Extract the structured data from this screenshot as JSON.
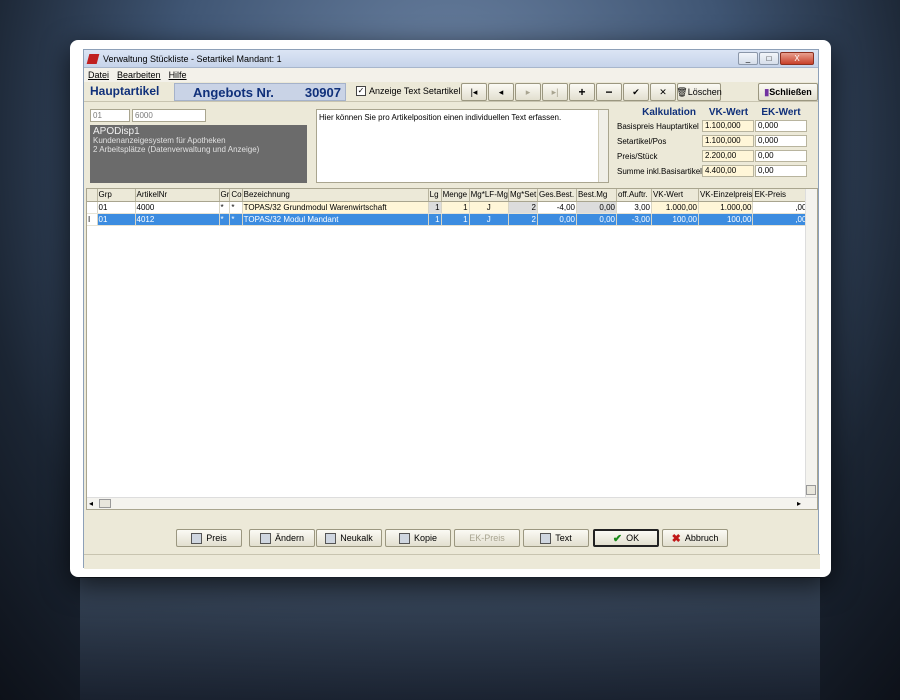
{
  "window": {
    "title": "Verwaltung Stückliste - Setartikel  Mandant: 1",
    "controls": [
      "_",
      "□",
      "X"
    ]
  },
  "menu": [
    "Datei",
    "Bearbeiten",
    "Hilfe"
  ],
  "header": {
    "hauptartikel": "Hauptartikel",
    "angebots_label": "Angebots Nr.",
    "angebots_number": "30907",
    "checkbox_label": "Anzeige Text Setartikel",
    "checkbox_checked": true
  },
  "toolbar": {
    "first": "|◂",
    "prev": "◂",
    "next": "▸",
    "last": "▸|",
    "plus": "+",
    "minus": "−",
    "ok": "✔",
    "cancel": "✕",
    "loeschen": "Löschen",
    "schliessen": "Schließen"
  },
  "article": {
    "grp": "01",
    "artnr": "6000",
    "name": "APODisp1",
    "line1": "Kundenanzeigesystem für Apotheken",
    "line2": "2 Arbeitsplätze (Datenverwaltung und Anzeige)"
  },
  "text_area": "Hier können Sie pro Artikelposition einen individuellen Text erfassen.",
  "kalkulation": {
    "title": "Kalkulation",
    "vk_header": "VK-Wert",
    "ek_header": "EK-Wert",
    "rows": [
      {
        "label": "Basispreis Hauptartikel",
        "vk": "1.100,000",
        "ek": "0,000"
      },
      {
        "label": "Setartikel/Pos",
        "vk": "1.100,000",
        "ek": "0,000"
      },
      {
        "label": "Preis/Stück",
        "vk": "2.200,00",
        "ek": "0,00"
      },
      {
        "label": "Summe inkl.Basisartikel",
        "vk": "4.400,00",
        "ek": "0,00"
      }
    ]
  },
  "table": {
    "headers": [
      "",
      "Grp",
      "ArtikelNr",
      "Gr",
      "Co",
      "Bezeichnung",
      "Lg",
      "Menge",
      "Mg*LF-Mg",
      "Mg*Set",
      "Ges.Best.",
      "Best.Mg",
      "off.Auftr.",
      "VK-Wert",
      "VK-Einzelpreis",
      "EK-Preis"
    ],
    "rows": [
      [
        "",
        "01",
        "4000",
        "*",
        "*",
        "TOPAS/32 Grundmodul  Warenwirtschaft",
        "1",
        "1",
        "J",
        "2",
        "-4,00",
        "0,00",
        "3,00",
        "1.000,00",
        "1.000,00",
        ",00"
      ],
      [
        "I",
        "01",
        "4012",
        "*",
        "*",
        "TOPAS/32 Modul Mandant",
        "1",
        "1",
        "J",
        "2",
        "0,00",
        "0,00",
        "-3,00",
        "100,00",
        "100,00",
        ",00"
      ]
    ]
  },
  "buttons": {
    "preis": "Preis",
    "aendern": "Ändern",
    "neukalk": "Neukalk",
    "kopie": "Kopie",
    "ekpreis": "EK-Preis",
    "text": "Text",
    "ok": "OK",
    "abbruch": "Abbruch"
  }
}
